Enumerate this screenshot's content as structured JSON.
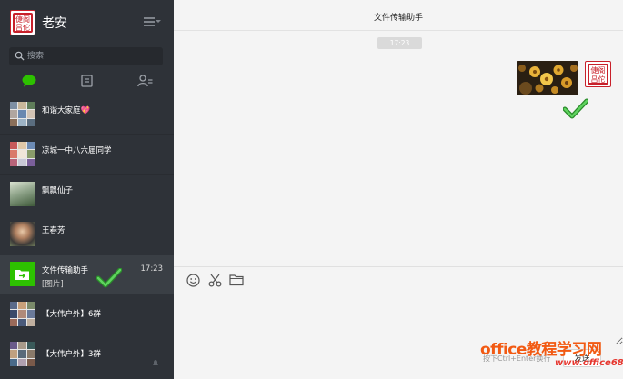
{
  "profile": {
    "name": "老安",
    "avatar_seal_text": "倢阁\n吕佗"
  },
  "search": {
    "placeholder": "搜索"
  },
  "nav_tabs": [
    {
      "icon": "chat-bubble-icon",
      "color": "#2dc100"
    },
    {
      "icon": "contacts-book-icon"
    },
    {
      "icon": "add-contact-icon"
    }
  ],
  "chats": [
    {
      "name": "和谐大家庭💖",
      "subtitle": "",
      "time": ""
    },
    {
      "name": "凉城一中八六届同学",
      "subtitle": "",
      "time": ""
    },
    {
      "name": "飘飘仙子",
      "subtitle": "",
      "time": ""
    },
    {
      "name": "王春芳",
      "subtitle": "",
      "time": ""
    },
    {
      "name": "文件传输助手",
      "subtitle": "[图片]",
      "time": "17:23"
    },
    {
      "name": "【大伟户外】6群",
      "subtitle": "",
      "time": ""
    },
    {
      "name": "【大伟户外】3群",
      "subtitle": "",
      "time": ""
    }
  ],
  "conversation": {
    "title": "文件传输助手",
    "timestamp": "17:23",
    "messages": [
      {
        "type": "image",
        "sender": "self",
        "description_icon": "flower-photo"
      }
    ]
  },
  "composer": {
    "tools": [
      "emoji-icon",
      "scissors-icon",
      "folder-icon"
    ],
    "send_hint": "按下Ctrl+Enter换行",
    "send_label": "发送"
  },
  "watermark": {
    "title": "office教程学习网",
    "url": "www.office68.com"
  },
  "colors": {
    "sidebar_bg": "#2e3238",
    "active_item_bg": "#3a3f45",
    "main_bg": "#f4f4f4",
    "accent_green": "#2dc100",
    "seal_red": "#c8202a",
    "watermark_orange": "#f25a13"
  }
}
